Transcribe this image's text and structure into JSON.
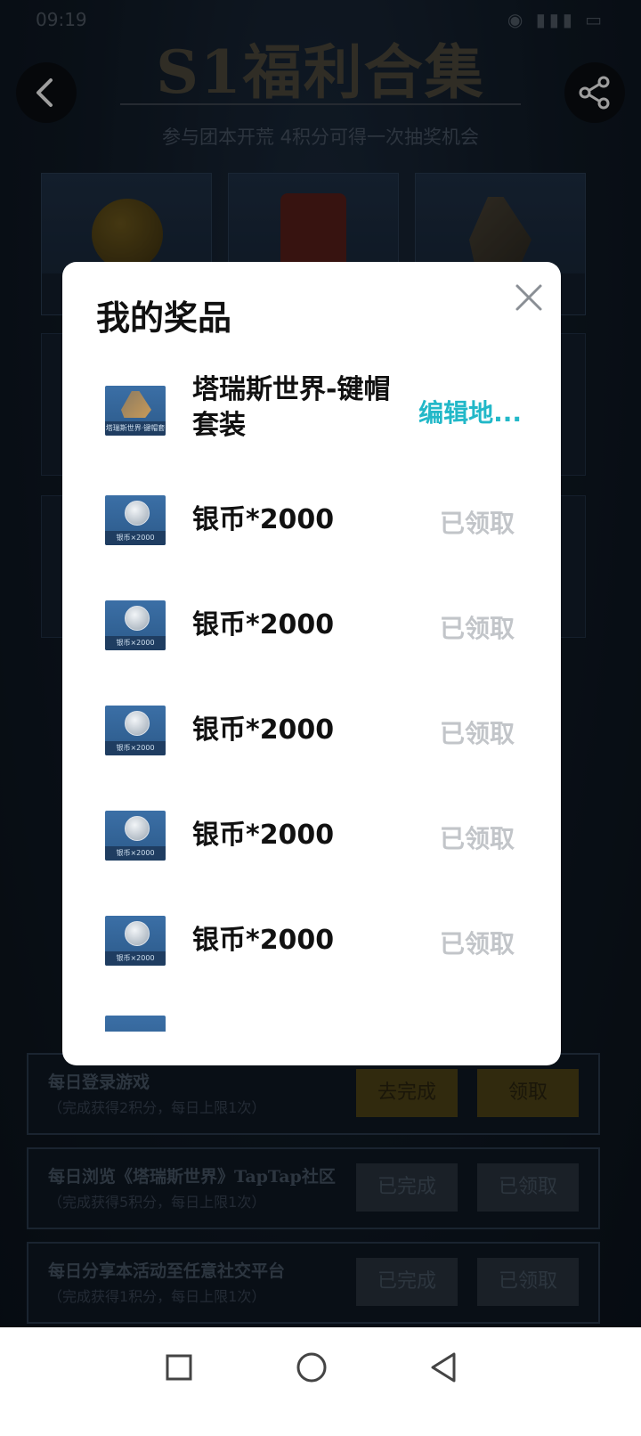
{
  "status_bar": {
    "time": "09:19",
    "indicators": "wifi signal battery"
  },
  "page": {
    "title": "S1福利合集",
    "subtitle": "参与团本开荒 4积分可得一次抽奖机会",
    "back_icon": "chevron-left-icon",
    "share_icon": "share-icon"
  },
  "tasks": [
    {
      "name": "每日登录游戏",
      "desc": "（完成获得2积分，每日上限1次）",
      "btn1": "去完成",
      "btn2": "领取",
      "style": "gold"
    },
    {
      "name": "每日浏览《塔瑞斯世界》TapTap社区",
      "desc": "（完成获得5积分，每日上限1次）",
      "btn1": "已完成",
      "btn2": "已领取",
      "style": "gray"
    },
    {
      "name": "每日分享本活动至任意社交平台",
      "desc": "（完成获得1积分，每日上限1次）",
      "btn1": "已完成",
      "btn2": "已领取",
      "style": "gray"
    }
  ],
  "modal": {
    "title": "我的奖品",
    "close_icon": "close-icon",
    "items": [
      {
        "name": "塔瑞斯世界-键帽套装",
        "thumb_label": "塔瑞斯世界·键帽套装",
        "action": "编辑地...",
        "state": "edit"
      },
      {
        "name": "银币*2000",
        "thumb_label": "银币×2000",
        "action": "已领取",
        "state": "claimed"
      },
      {
        "name": "银币*2000",
        "thumb_label": "银币×2000",
        "action": "已领取",
        "state": "claimed"
      },
      {
        "name": "银币*2000",
        "thumb_label": "银币×2000",
        "action": "已领取",
        "state": "claimed"
      },
      {
        "name": "银币*2000",
        "thumb_label": "银币×2000",
        "action": "已领取",
        "state": "claimed"
      },
      {
        "name": "银币*2000",
        "thumb_label": "银币×2000",
        "action": "已领取",
        "state": "claimed"
      }
    ]
  },
  "colors": {
    "accent": "#22b8c8",
    "claimed": "#c2c5c9",
    "modal_bg": "#ffffff"
  },
  "navbar": {
    "recent_icon": "square-icon",
    "home_icon": "circle-icon",
    "back_icon": "triangle-back-icon"
  }
}
